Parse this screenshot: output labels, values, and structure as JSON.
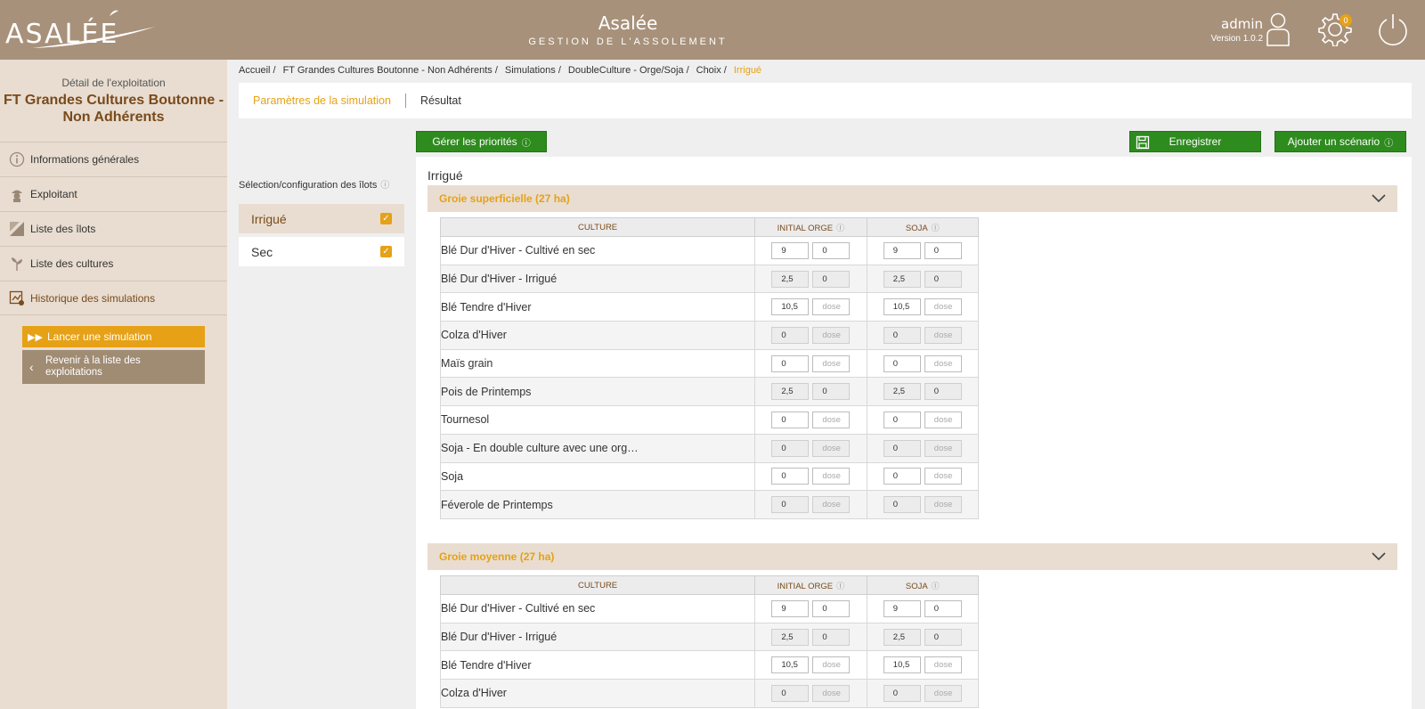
{
  "header": {
    "logo_text": "ASALÉE",
    "app_title": "Asalée",
    "app_subtitle": "GESTION DE L'ASSOLEMENT",
    "user_name": "admin",
    "version": "Version 1.0.2",
    "notif_count": "0"
  },
  "sidebar": {
    "farm_label": "Détail de l'exploitation",
    "farm_name": "FT Grandes Cultures Boutonne - Non Adhérents",
    "items": [
      {
        "label": "Informations générales",
        "icon": "info-icon"
      },
      {
        "label": "Exploitant",
        "icon": "farmer-icon"
      },
      {
        "label": "Liste des îlots",
        "icon": "field-icon"
      },
      {
        "label": "Liste des cultures",
        "icon": "plant-icon"
      },
      {
        "label": "Historique des simulations",
        "icon": "history-icon"
      }
    ],
    "launch_label": "Lancer une simulation",
    "back_label": "Revenir à la liste des exploitations"
  },
  "breadcrumb": [
    "Accueil /",
    "FT Grandes Cultures Boutonne - Non Adhérents /",
    "Simulations /",
    "DoubleCulture - Orge/Soja /",
    "Choix /",
    "Irrigué"
  ],
  "tabs": {
    "params": "Paramètres de la simulation",
    "result": "Résultat"
  },
  "toolbar": {
    "priorities": "Gérer les priorités",
    "save": "Enregistrer",
    "add_scenario": "Ajouter un scénario"
  },
  "config": {
    "title": "Sélection/configuration des îlots",
    "options": [
      {
        "label": "Irrigué",
        "checked": true
      },
      {
        "label": "Sec",
        "checked": true
      }
    ]
  },
  "main": {
    "section_title": "Irrigué",
    "columns": [
      "CULTURE",
      "INITIAL ORGE",
      "SOJA"
    ],
    "dose_placeholder": "dose",
    "groups": [
      {
        "title": "Groie superficielle (27 ha)",
        "rows": [
          {
            "name": "Blé Dur d'Hiver - Cultivé en sec",
            "a1": "9",
            "a2": "0",
            "b1": "9",
            "b2": "0",
            "ro": false,
            "ph": false
          },
          {
            "name": "Blé Dur d'Hiver - Irrigué",
            "a1": "2,5",
            "a2": "0",
            "b1": "2,5",
            "b2": "0",
            "ro": true,
            "ph": false
          },
          {
            "name": "Blé Tendre d'Hiver",
            "a1": "10,5",
            "a2": "dose",
            "b1": "10,5",
            "b2": "dose",
            "ro": false,
            "ph": true
          },
          {
            "name": "Colza d'Hiver",
            "a1": "0",
            "a2": "dose",
            "b1": "0",
            "b2": "dose",
            "ro": true,
            "ph": true
          },
          {
            "name": "Maïs grain",
            "a1": "0",
            "a2": "dose",
            "b1": "0",
            "b2": "dose",
            "ro": false,
            "ph": true
          },
          {
            "name": "Pois de Printemps",
            "a1": "2,5",
            "a2": "0",
            "b1": "2,5",
            "b2": "0",
            "ro": true,
            "ph": false
          },
          {
            "name": "Tournesol",
            "a1": "0",
            "a2": "dose",
            "b1": "0",
            "b2": "dose",
            "ro": false,
            "ph": true
          },
          {
            "name": "Soja - En double culture avec une org…",
            "a1": "0",
            "a2": "dose",
            "b1": "0",
            "b2": "dose",
            "ro": true,
            "ph": true
          },
          {
            "name": "Soja",
            "a1": "0",
            "a2": "dose",
            "b1": "0",
            "b2": "dose",
            "ro": false,
            "ph": true
          },
          {
            "name": "Féverole de Printemps",
            "a1": "0",
            "a2": "dose",
            "b1": "0",
            "b2": "dose",
            "ro": true,
            "ph": true
          }
        ]
      },
      {
        "title": "Groie moyenne (27 ha)",
        "rows": [
          {
            "name": "Blé Dur d'Hiver - Cultivé en sec",
            "a1": "9",
            "a2": "0",
            "b1": "9",
            "b2": "0",
            "ro": false,
            "ph": false
          },
          {
            "name": "Blé Dur d'Hiver - Irrigué",
            "a1": "2,5",
            "a2": "0",
            "b1": "2,5",
            "b2": "0",
            "ro": true,
            "ph": false
          },
          {
            "name": "Blé Tendre d'Hiver",
            "a1": "10,5",
            "a2": "dose",
            "b1": "10,5",
            "b2": "dose",
            "ro": false,
            "ph": true
          },
          {
            "name": "Colza d'Hiver",
            "a1": "0",
            "a2": "dose",
            "b1": "0",
            "b2": "dose",
            "ro": true,
            "ph": true
          }
        ]
      }
    ]
  }
}
